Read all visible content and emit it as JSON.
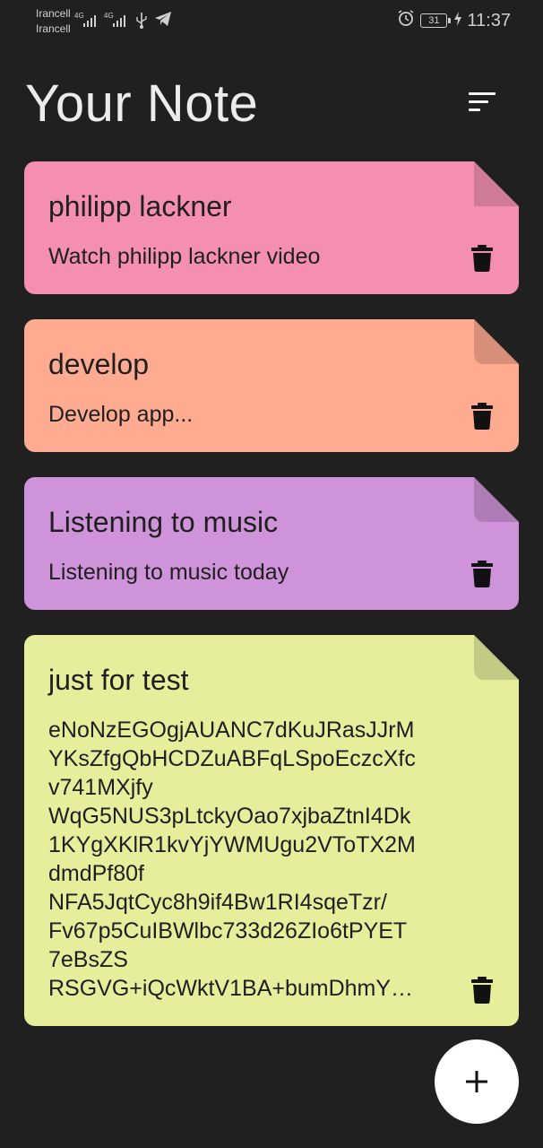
{
  "status_bar": {
    "carrier_1": "Irancell",
    "carrier_2": "Irancell",
    "network_1": "4G",
    "network_2": "4G",
    "battery": "31",
    "time": "11:37"
  },
  "header": {
    "title": "Your Note"
  },
  "notes": [
    {
      "title": "philipp lackner",
      "content": "Watch philipp lackner video",
      "color": "#F48FB1",
      "corner_color": "#CF7A97"
    },
    {
      "title": "develop",
      "content": "Develop app...",
      "color": "#FFAB91",
      "corner_color": "#D88F79"
    },
    {
      "title": "Listening to music",
      "content": "Listening to music today",
      "color": "#CE93D8",
      "corner_color": "#AE7DB7"
    },
    {
      "title": "just for test",
      "content_lines": [
        "eNoNzEGOgjAUANC7dKuJRasJJrM",
        "YKsZfgQbHCDZuABFqLSpoEczcXfc",
        "v741MXjfy",
        "WqG5NUS3pLtckyOao7xjbaZtnI4Dk",
        "1KYgXKlR1kvYjYWMUgu2VToTX2M",
        "dmdPf80f",
        "NFA5JqtCyc8h9if4Bw1RI4sqeTzr/",
        "Fv67p5CuIBWlbc733d26ZIo6tPYET",
        "7eBsZS",
        "RSGVG+iQcWktV1BA+bumDhmY…"
      ],
      "color": "#E6EE9C",
      "corner_color": "#C3CA84"
    }
  ],
  "icons": {
    "sort": "sort-icon",
    "delete": "trash-icon",
    "add": "plus-icon"
  },
  "fab": {
    "label": "+"
  }
}
